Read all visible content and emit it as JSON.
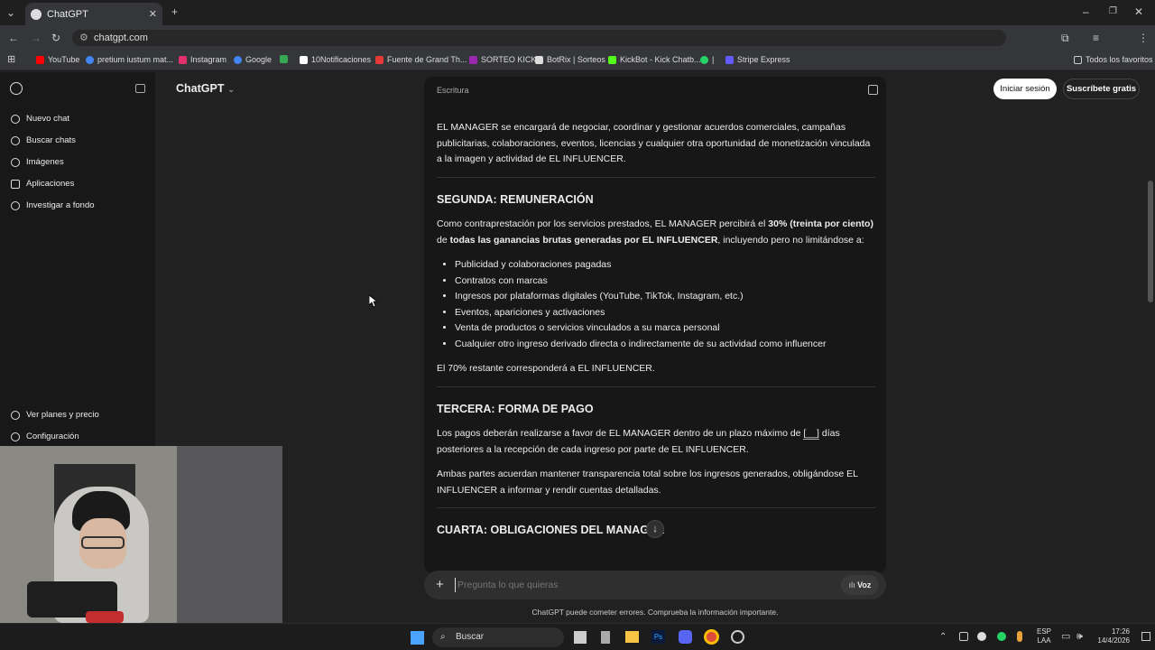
{
  "browser": {
    "tab_title": "ChatGPT",
    "url": "chatgpt.com",
    "bookmarks": [
      {
        "label": "YouTube",
        "color": "#ff0000"
      },
      {
        "label": "pretium iustum mat...",
        "color": "#4285f4"
      },
      {
        "label": "Instagram",
        "color": "#e1306c"
      },
      {
        "label": "Google",
        "color": "#4285f4"
      },
      {
        "label": "",
        "color": "#34a853"
      },
      {
        "label": "10Notificaciones",
        "color": "#ffffff"
      },
      {
        "label": "Fuente de Grand Th...",
        "color": "#e53935"
      },
      {
        "label": "SORTEO KICK",
        "color": "#9c27b0"
      },
      {
        "label": "BotRix | Sorteos",
        "color": "#dddddd"
      },
      {
        "label": "KickBot - Kick Chatb...",
        "color": "#53fc18"
      },
      {
        "label": "|",
        "color": "#25d366"
      },
      {
        "label": "Stripe Express",
        "color": "#635bff"
      }
    ],
    "all_bookmarks": "Todos los favoritos"
  },
  "sidebar": {
    "items": [
      {
        "label": "Nuevo chat",
        "icon": "edit-icon"
      },
      {
        "label": "Buscar chats",
        "icon": "search-icon"
      },
      {
        "label": "Imágenes",
        "icon": "image-icon"
      },
      {
        "label": "Aplicaciones",
        "icon": "apps-icon"
      },
      {
        "label": "Investigar a fondo",
        "icon": "telescope-icon"
      }
    ],
    "bottom": [
      {
        "label": "Ver planes y precio"
      },
      {
        "label": "Configuración"
      }
    ]
  },
  "header": {
    "model": "ChatGPT",
    "login": "Iniciar sesión",
    "signup": "Suscríbete gratis"
  },
  "card": {
    "label": "Escritura",
    "p1": "EL MANAGER se encargará de negociar, coordinar y gestionar acuerdos comerciales, campañas publicitarias, colaboraciones, eventos, licencias y cualquier otra oportunidad de monetización vinculada a la imagen y actividad de EL INFLUENCER.",
    "h2": "SEGUNDA: REMUNERACIÓN",
    "p2_a": "Como contraprestación por los servicios prestados, EL MANAGER percibirá el ",
    "p2_b": "30% (treinta por ciento)",
    "p2_c": " de ",
    "p2_d": "todas las ganancias brutas generadas por EL INFLUENCER",
    "p2_e": ", incluyendo pero no limitándose a:",
    "list": [
      "Publicidad y colaboraciones pagadas",
      "Contratos con marcas",
      "Ingresos por plataformas digitales (YouTube, TikTok, Instagram, etc.)",
      "Eventos, apariciones y activaciones",
      "Venta de productos o servicios vinculados a su marca personal",
      "Cualquier otro ingreso derivado directa o indirectamente de su actividad como influencer"
    ],
    "p3": "El 70% restante corresponderá a EL INFLUENCER.",
    "h3": "TERCERA: FORMA DE PAGO",
    "p4_a": "Los pagos deberán realizarse a favor de EL MANAGER dentro de un plazo máximo de ",
    "p4_b": "[__]",
    "p4_c": " días posteriores a la recepción de cada ingreso por parte de EL INFLUENCER.",
    "p5": "Ambas partes acuerdan mantener transparencia total sobre los ingresos generados, obligándose EL INFLUENCER a informar y rendir cuentas detalladas.",
    "h4": "CUARTA: OBLIGACIONES DEL MANAGER"
  },
  "composer": {
    "placeholder": "Pregunta lo que quieras",
    "voice": "Voz",
    "disclaimer": "ChatGPT puede cometer errores. Comprueba la información importante."
  },
  "taskbar": {
    "search": "Buscar",
    "lang1": "ESP",
    "lang2": "LAA",
    "time": "17:26",
    "date": "14/4/2026"
  }
}
